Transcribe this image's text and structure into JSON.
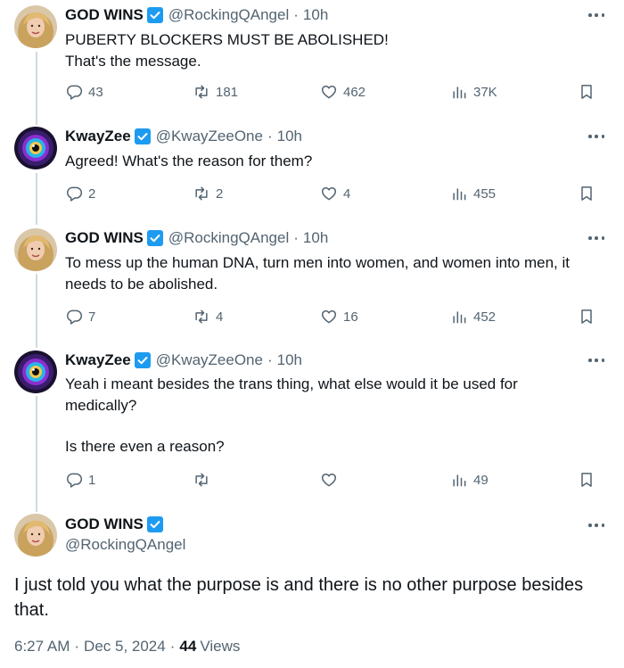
{
  "colors": {
    "verified": "#1d9bf0",
    "muted": "#536471",
    "text": "#0f1419",
    "thread_line": "#cfd9de"
  },
  "replies": [
    {
      "name": "GOD WINS",
      "handle": "@RockingQAngel",
      "sep": "·",
      "time": "10h",
      "avatar": "blonde-woman-avatar",
      "lines": [
        "PUBERTY BLOCKERS MUST BE ABOLISHED!",
        "That's the message."
      ],
      "reply_count": "43",
      "retweet_count": "181",
      "like_count": "462",
      "view_count": "37K"
    },
    {
      "name": "KwayZee",
      "handle": "@KwayZeeOne",
      "sep": "·",
      "time": "10h",
      "avatar": "glowing-eye-avatar",
      "lines": [
        "Agreed! What's the reason for them?"
      ],
      "reply_count": "2",
      "retweet_count": "2",
      "like_count": "4",
      "view_count": "455"
    },
    {
      "name": "GOD WINS",
      "handle": "@RockingQAngel",
      "sep": "·",
      "time": "10h",
      "avatar": "blonde-woman-avatar",
      "lines": [
        "To mess up the human DNA, turn men into women, and women into men, it",
        "needs to be abolished."
      ],
      "reply_count": "7",
      "retweet_count": "4",
      "like_count": "16",
      "view_count": "452"
    },
    {
      "name": "KwayZee",
      "handle": "@KwayZeeOne",
      "sep": "·",
      "time": "10h",
      "avatar": "glowing-eye-avatar",
      "lines": [
        "Yeah i meant besides the trans thing, what else would it be used for",
        "medically?",
        "",
        "Is there even a reason?"
      ],
      "reply_count": "1",
      "retweet_count": "",
      "like_count": "",
      "view_count": "49"
    }
  ],
  "main_tweet": {
    "name": "GOD WINS",
    "handle": "@RockingQAngel",
    "text_line1": "I just told you what the purpose is and there is no other purpose besides",
    "text_line2": "that.",
    "time": "6:27 AM",
    "date": "Dec 5, 2024",
    "sep": "·",
    "views_count": "44",
    "views_label": "Views"
  }
}
